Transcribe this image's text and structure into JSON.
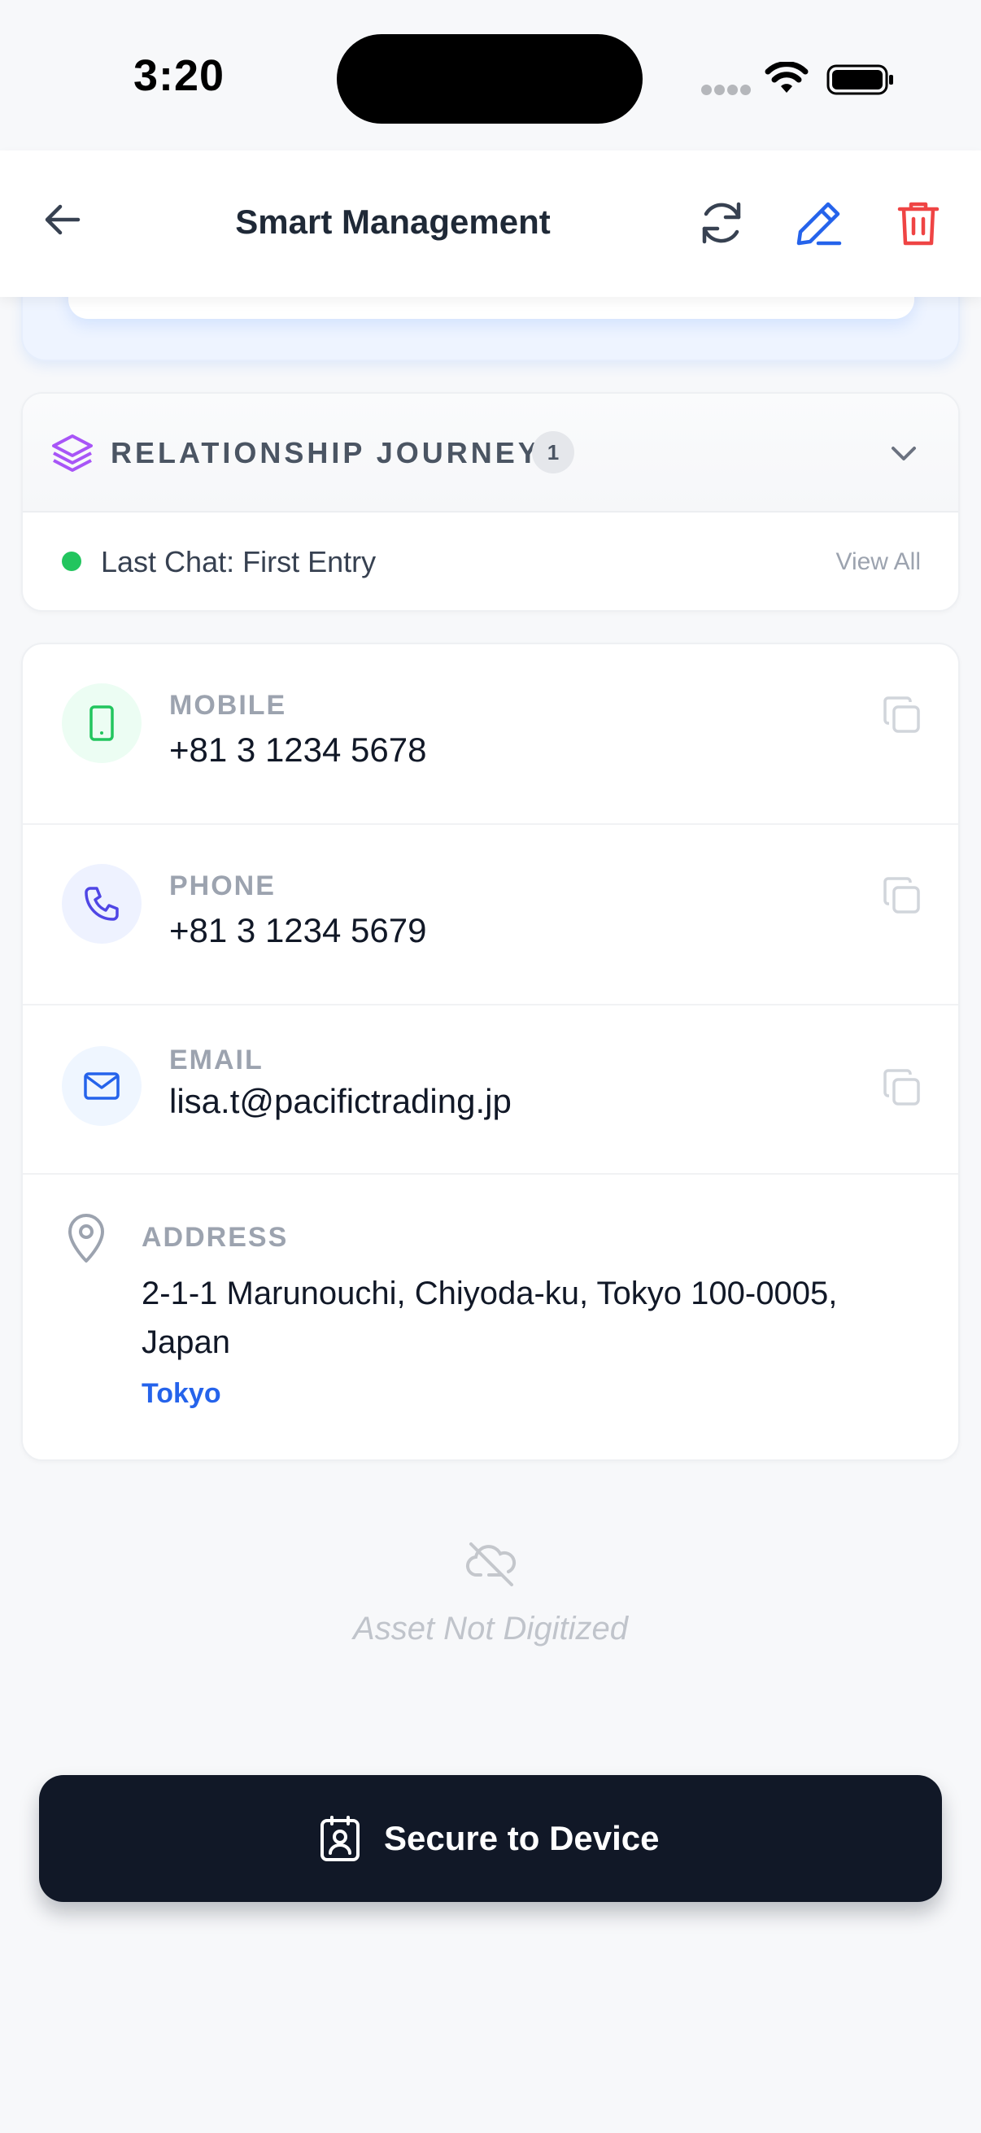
{
  "status_bar": {
    "time": "3:20"
  },
  "header": {
    "title": "Smart Management",
    "icons": [
      "back-arrow-icon",
      "refresh-icon",
      "edit-pencil-icon",
      "trash-icon"
    ],
    "colors": {
      "edit": "#2563eb",
      "delete": "#ef4444",
      "refresh": "#374151"
    }
  },
  "journey": {
    "title": "RELATIONSHIP JOURNEY",
    "count": "1",
    "last_chat": "Last Chat: First Entry",
    "view_all": "View All",
    "accent_color": "#a855f7",
    "status_color": "#22c55e"
  },
  "contact": {
    "mobile": {
      "label": "MOBILE",
      "value": "+81 3 1234 5678"
    },
    "phone": {
      "label": "PHONE",
      "value": "+81 3 1234 5679"
    },
    "email": {
      "label": "EMAIL",
      "value": "lisa.t@pacifictrading.jp"
    },
    "address": {
      "label": "ADDRESS",
      "value": "2-1-1 Marunouchi, Chiyoda-ku, Tokyo 100-0005, Japan",
      "city": "Tokyo"
    }
  },
  "asset": {
    "status": "Asset Not Digitized"
  },
  "action": {
    "label": "Secure to Device"
  }
}
